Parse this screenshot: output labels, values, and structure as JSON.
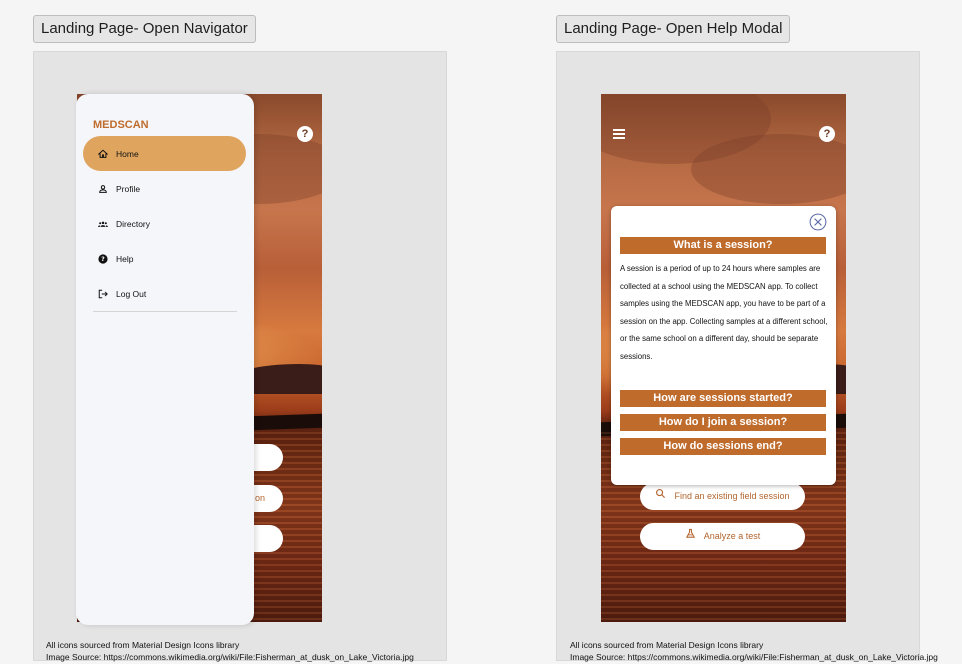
{
  "left_frame": {
    "label": "Landing Page- Open Navigator",
    "drawer": {
      "title": "MEDSCAN",
      "items": [
        {
          "label": "Home",
          "icon": "home-icon",
          "active": true
        },
        {
          "label": "Profile",
          "icon": "person-icon",
          "active": false
        },
        {
          "label": "Directory",
          "icon": "group-icon",
          "active": false
        },
        {
          "label": "Help",
          "icon": "help-circle-icon",
          "active": false
        },
        {
          "label": "Log Out",
          "icon": "logout-icon",
          "active": false
        }
      ]
    },
    "pills": [
      "on"
    ],
    "footer": {
      "icons_note": "All icons sourced from Material Design Icons library",
      "image_source": "Image Source: https://commons.wikimedia.org/wiki/File:Fisherman_at_dusk_on_Lake_Victoria.jpg"
    }
  },
  "right_frame": {
    "label": "Landing Page- Open Help Modal",
    "help_button": "?",
    "modal": {
      "headings": [
        "What is a session?",
        "How are sessions started?",
        "How do I join a session?",
        "How do sessions end?"
      ],
      "body": "A session is a period of up to 24 hours where samples are collected at a school using the MEDSCAN app. To collect samples using the MEDSCAN app, you have to be part of a session on the app. Collecting samples at a different school, or the same school on a different day, should be separate sessions."
    },
    "actions": [
      {
        "label": "Find an existing field session",
        "icon": "search-icon"
      },
      {
        "label": "Analyze a test",
        "icon": "flask-icon"
      }
    ],
    "footer": {
      "icons_note": "All icons sourced from Material Design Icons library",
      "image_source": "Image Source: https://commons.wikimedia.org/wiki/File:Fisherman_at_dusk_on_Lake_Victoria.jpg"
    }
  },
  "colors": {
    "accent": "#bf6b2c",
    "active_nav": "#dfa55e",
    "drawer_bg": "#f5f6fa"
  }
}
